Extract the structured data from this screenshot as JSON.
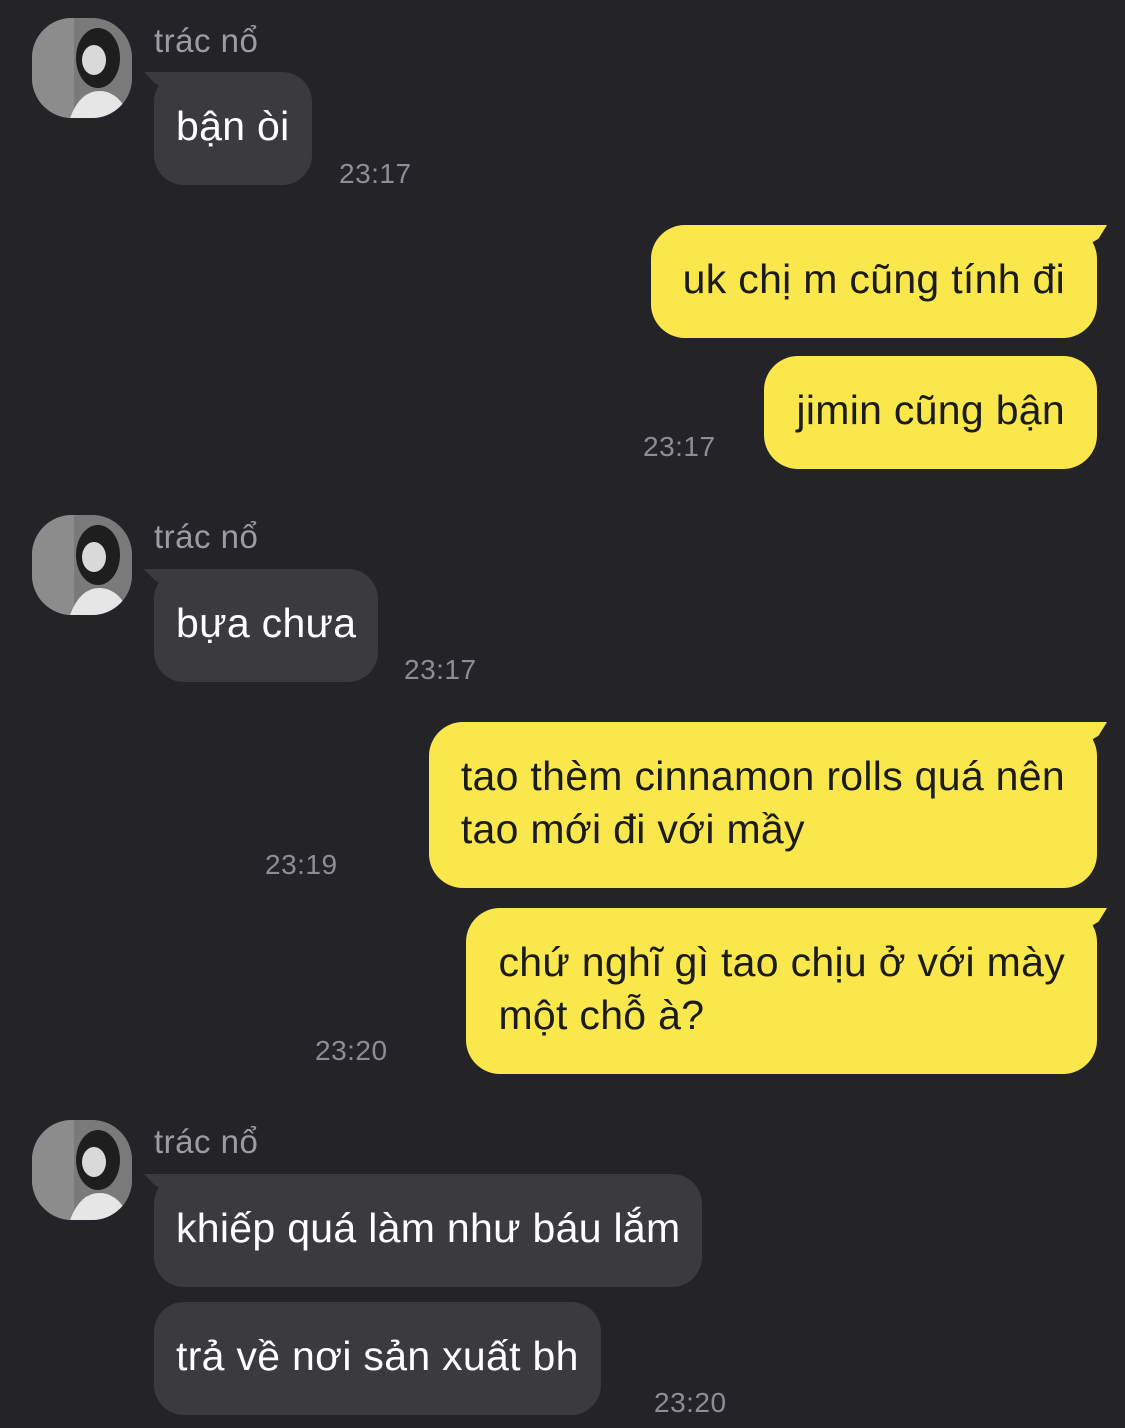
{
  "contact": {
    "name": "trác nổ"
  },
  "colors": {
    "background": "#242428",
    "incoming_bubble": "#3b3b3f",
    "outgoing_bubble": "#f9e74b",
    "timestamp": "#8d8d93"
  },
  "messages": [
    {
      "direction": "in",
      "text": "bận òi",
      "time": "23:17"
    },
    {
      "direction": "out",
      "text": "uk chị m cũng tính đi",
      "time": ""
    },
    {
      "direction": "out",
      "text": "jimin cũng bận",
      "time": "23:17"
    },
    {
      "direction": "in",
      "text": "bựa chưa",
      "time": "23:17"
    },
    {
      "direction": "out",
      "lines": [
        "tao thèm cinnamon rolls quá nên",
        "tao mới đi với mầy"
      ],
      "time": "23:19"
    },
    {
      "direction": "out",
      "lines": [
        "chứ nghĩ gì tao chịu ở với mày",
        "một chỗ à?"
      ],
      "time": "23:20"
    },
    {
      "direction": "in",
      "text": "khiếp quá làm như báu lắm",
      "time": ""
    },
    {
      "direction": "in",
      "text": "trả về nơi sản xuất bh",
      "time": "23:20"
    }
  ]
}
